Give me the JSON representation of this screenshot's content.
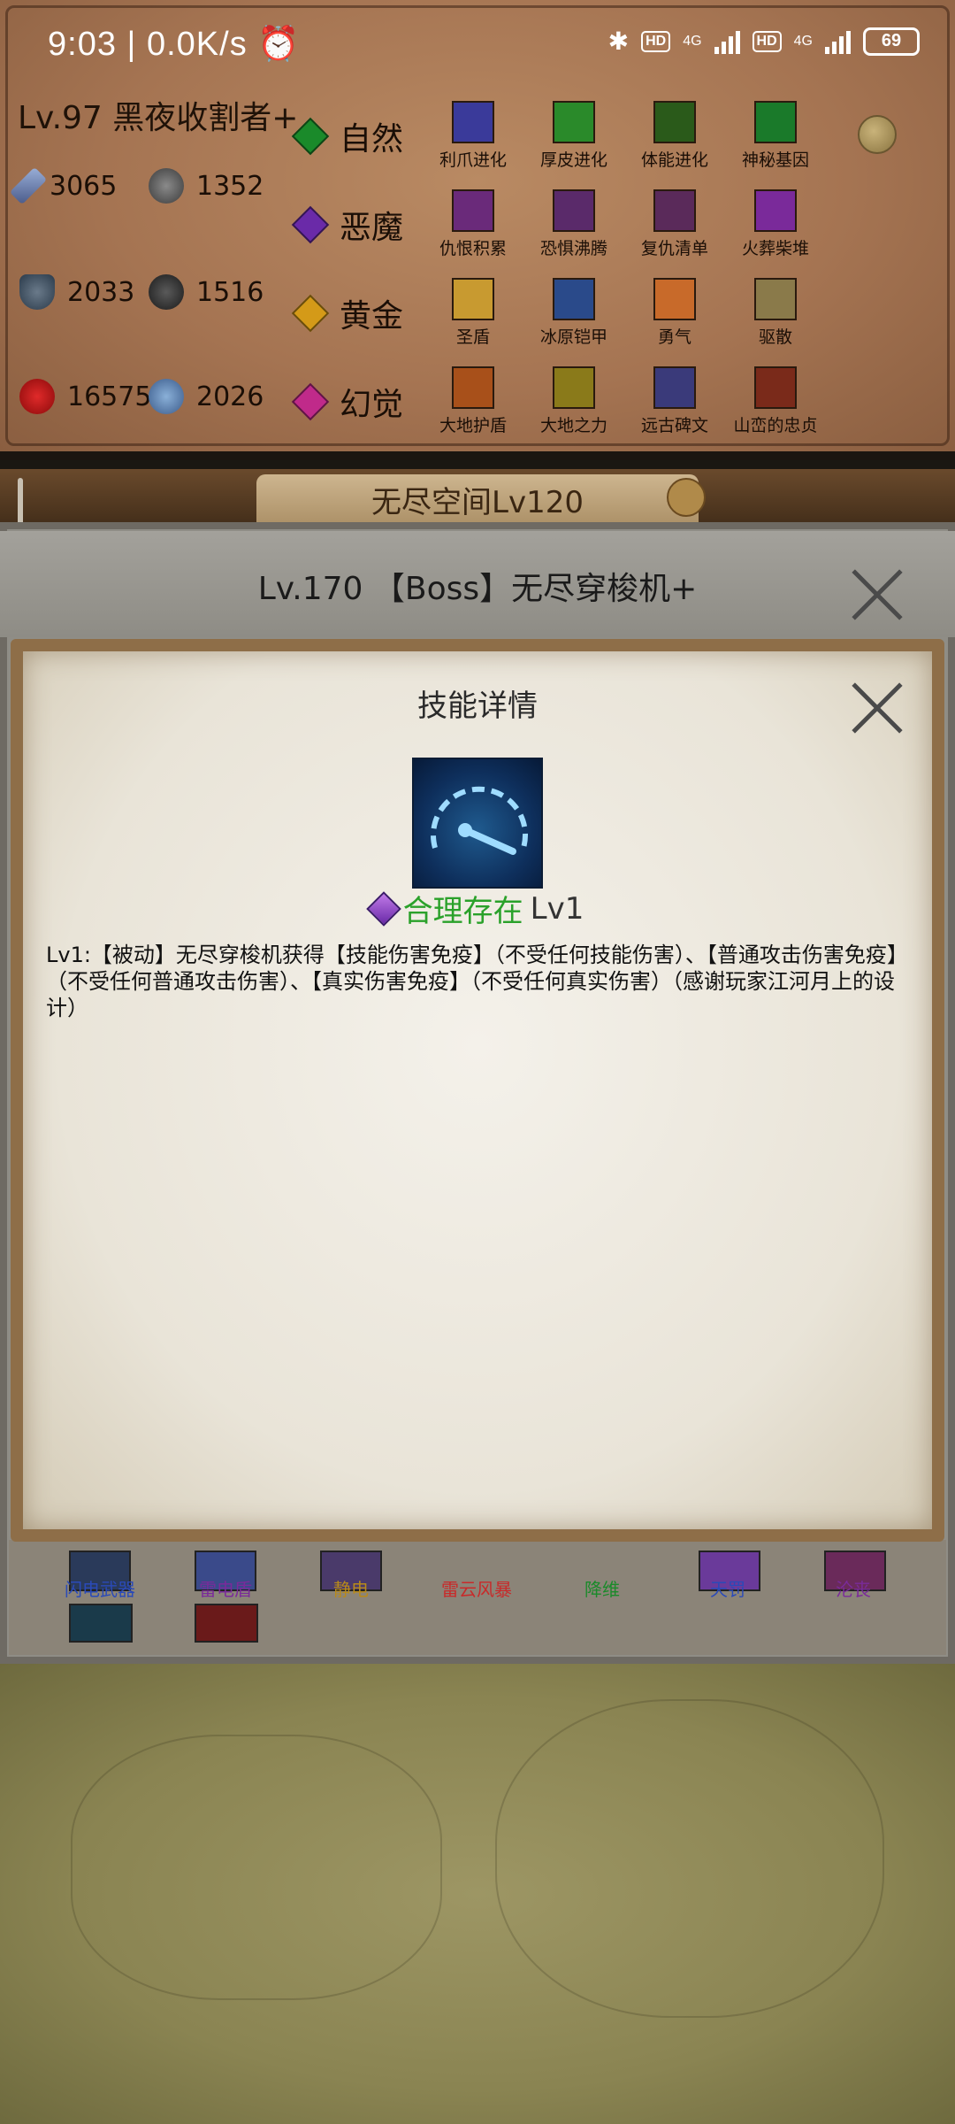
{
  "status_bar": {
    "time": "9:03",
    "net_speed": "0.0K/s",
    "battery": "69",
    "net1": "4G",
    "net2": "4G",
    "hd": "HD"
  },
  "hero": {
    "name": "Lv.97 黑夜收割者+",
    "stats": {
      "attack": "3065",
      "attack2": "1352",
      "defense": "2033",
      "defense2": "1516",
      "hp": "16575",
      "mana": "2026"
    }
  },
  "elements": [
    {
      "label": "自然",
      "color": "#1a8a2a",
      "skills": [
        "利爪进化",
        "厚皮进化",
        "体能进化",
        "神秘基因"
      ],
      "icon_colors": [
        "#3a3a9a",
        "#2a8a2a",
        "#2a5a1a",
        "#1a7a2a"
      ]
    },
    {
      "label": "恶魔",
      "color": "#6a2aa8",
      "skills": [
        "仇恨积累",
        "恐惧沸腾",
        "复仇清单",
        "火葬柴堆"
      ],
      "icon_colors": [
        "#6a2a7a",
        "#5a2a6a",
        "#5a2a5a",
        "#7a2a9a"
      ]
    },
    {
      "label": "黄金",
      "color": "#d49a18",
      "skills": [
        "圣盾",
        "冰原铠甲",
        "勇气",
        "驱散"
      ],
      "icon_colors": [
        "#c89a30",
        "#2a4a8a",
        "#c86a2a",
        "#8a7a4a"
      ]
    },
    {
      "label": "幻觉",
      "color": "#c02a8a",
      "skills": [
        "大地护盾",
        "大地之力",
        "远古碑文",
        "山峦的忠贞"
      ],
      "icon_colors": [
        "#a8501a",
        "#8a7a1a",
        "#3a3a7a",
        "#7a2a1a"
      ]
    }
  ],
  "zone": {
    "title": "无尽空间Lv120"
  },
  "boss": {
    "title": "Lv.170 【Boss】无尽穿梭机+"
  },
  "dialog": {
    "title": "技能详情",
    "skill_name": "合理存在",
    "skill_level": "Lv1",
    "description": "Lv1:【被动】无尽穿梭机获得【技能伤害免疫】（不受任何技能伤害）、【普通攻击伤害免疫】（不受任何普通攻击伤害）、【真实伤害免疫】（不受任何真实伤害）（感谢玩家江河月上的设计）"
  },
  "lower_strip": {
    "labels": [
      "闪电武器",
      "雷电盾",
      "静电",
      "雷云风暴",
      "降维",
      "天罚",
      "沦丧"
    ],
    "label_colors": [
      "#2a4ab8",
      "#7a2a9a",
      "#b88a1a",
      "#c82a2a",
      "#1a8a2a",
      "#2a4ab8",
      "#7a2a9a"
    ]
  },
  "colors": {
    "skill_name_green": "#2aa12a",
    "dialog_border": "#8e6e48"
  }
}
